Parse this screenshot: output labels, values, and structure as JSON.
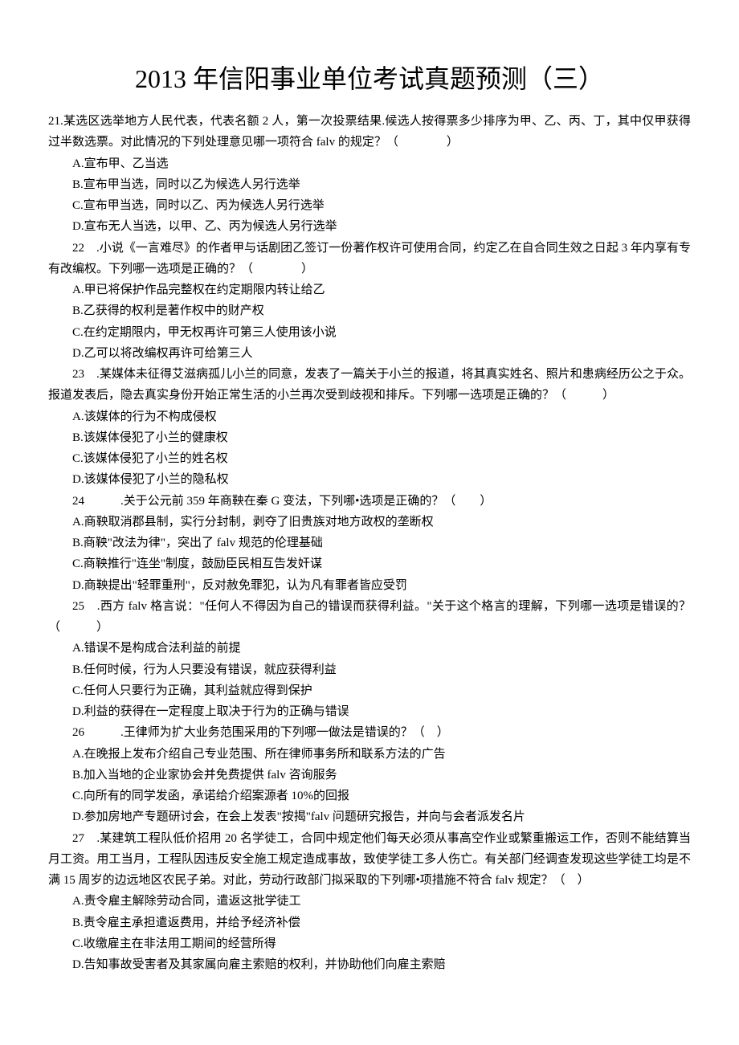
{
  "title": "2013 年信阳事业单位考试真题预测（三）",
  "questions": [
    {
      "num": "21.",
      "stem": "某选区选举地方人民代表，代表名额 2 人，第一次投票结果.候选人按得票多少排序为甲、乙、丙、丁，其中仅甲获得过半数选票。对此情况的下列处理意见哪一项符合 falv 的规定？（　　　　）",
      "opts": [
        "A.宣布甲、乙当选",
        "B.宣布甲当选，同时以乙为候选人另行选举",
        "C.宣布甲当选，同时以乙、丙为候选人另行选举",
        "D.宣布无人当选，以甲、乙、丙为候选人另行选举"
      ]
    },
    {
      "num": "22　.",
      "stem": "小说《一言难尽》的作者甲与话剧团乙签订一份著作权许可使用合同，约定乙在自合同生效之日起 3 年内享有专有改编权。下列哪一选项是正确的？（　　　　）",
      "opts": [
        "A.甲已将保护作品完整权在约定期限内转让给乙",
        "B.乙获得的权利是著作权中的财产权",
        "C.在约定期限内，甲无权再许可第三人使用该小说",
        "D.乙可以将改编权再许可给第三人"
      ]
    },
    {
      "num": "23　.",
      "stem": "某媒体未征得艾滋病孤儿小兰的同意，发表了一篇关于小兰的报道，将其真实姓名、照片和患病经历公之于众。报道发表后，隐去真实身份开始正常生活的小兰再次受到歧视和排斥。下列哪一选项是正确的？（　　　）",
      "opts": [
        "A.该媒体的行为不构成侵权",
        "B.该媒体侵犯了小兰的健康权",
        "C.该媒体侵犯了小兰的姓名权",
        "D.该媒体侵犯了小兰的隐私权"
      ]
    },
    {
      "num": "24　　　.",
      "stem": "关于公元前 359 年商鞅在秦 G 变法，下列哪•选项是正确的？（　　）",
      "opts": [
        "A.商鞅取消郡县制，实行分封制，剥夺了旧贵族对地方政权的垄断权",
        "B.商鞅\"改法为律\"，突出了 falv 规范的伦理基础",
        "C.商鞅推行\"连坐\"制度，鼓励臣民相互告发奸谋",
        "D.商鞅提出\"轻罪重刑\"，反对赦免罪犯，认为凡有罪者皆应受罚"
      ]
    },
    {
      "num": "25　.",
      "stem": "西方 falv 格言说：\"任何人不得因为自己的错误而获得利益。\"关于这个格言的理解，下列哪一选项是错误的？（　　　）",
      "opts": [
        "A.错误不是构成合法利益的前提",
        "B.任何时候，行为人只要没有错误，就应获得利益",
        "C.任何人只要行为正确，其利益就应得到保护",
        "D.利益的获得在一定程度上取决于行为的正确与错误"
      ]
    },
    {
      "num": "26　　　.",
      "stem": "王律师为扩大业务范围采用的下列哪一做法是错误的？（　）",
      "opts": [
        "A.在晚报上发布介绍自己专业范围、所在律师事务所和联系方法的广告",
        "B.加入当地的企业家协会并免费提供 falv 咨询服务",
        "C.向所有的同学发函，承诺给介绍案源者 10%的回报",
        "D.参加房地产专题研讨会，在会上发表\"按揭\"falv 问题研究报告，并向与会者派发名片"
      ]
    },
    {
      "num": "27　.",
      "stem": "某建筑工程队低价招用 20 名学徒工，合同中规定他们每天必须从事高空作业或繁重搬运工作，否则不能结算当月工资。用工当月，工程队因违反安全施工规定造成事故，致使学徒工多人伤亡。有关部门经调查发现这些学徒工均是不满 15 周岁的边远地区农民子弟。对此，劳动行政部门拟采取的下列哪•项措施不符合 falv 规定？（　）",
      "opts": [
        "A.责令雇主解除劳动合同，遣返这批学徒工",
        "B.责令雇主承担遣返费用，并给予经济补偿",
        "C.收缴雇主在非法用工期间的经营所得",
        "D.告知事故受害者及其家属向雇主索赔的权利，并协助他们向雇主索赔"
      ]
    }
  ]
}
